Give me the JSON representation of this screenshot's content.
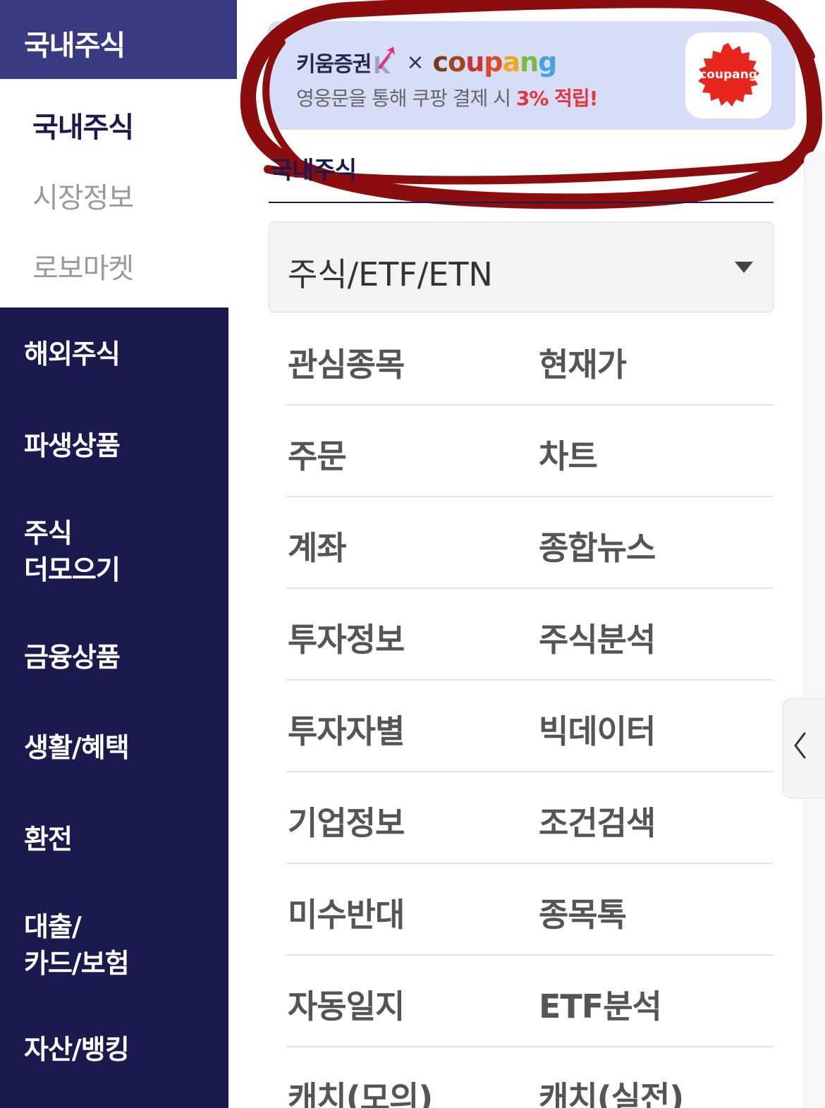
{
  "sidebar": {
    "active_category": "국내주식",
    "sub_items": [
      {
        "label": "국내주식",
        "active": true
      },
      {
        "label": "시장정보",
        "active": false
      },
      {
        "label": "로보마켓",
        "active": false
      }
    ],
    "categories": [
      {
        "label": "해외주식"
      },
      {
        "label": "파생상품"
      },
      {
        "label": "주식\n더모으기"
      },
      {
        "label": "금융상품"
      },
      {
        "label": "생활/혜택"
      },
      {
        "label": "환전"
      },
      {
        "label": "대출/\n카드/보험"
      },
      {
        "label": "자산/뱅킹"
      }
    ]
  },
  "banner": {
    "brand_left": "키움증권",
    "times_symbol": "×",
    "brand_right": "coupang",
    "description_prefix": "영웅문을 통해 쿠팡 결제 시 ",
    "description_highlight": "3% 적립!",
    "app_icon_label": "coupang",
    "colors": {
      "background": "#d5ddf7",
      "highlight": "#e8323c",
      "badge": "#e8261e"
    }
  },
  "section": {
    "title": "국내주식"
  },
  "dropdown": {
    "selected": "주식/ETF/ETN"
  },
  "menu": {
    "rows": [
      {
        "left": "관심종목",
        "right": "현재가"
      },
      {
        "left": "주문",
        "right": "차트"
      },
      {
        "left": "계좌",
        "right": "종합뉴스"
      },
      {
        "left": "투자정보",
        "right": "주식분석"
      },
      {
        "left": "투자자별",
        "right": "빅데이터"
      },
      {
        "left": "기업정보",
        "right": "조건검색"
      },
      {
        "left": "미수반대",
        "right": "종목톡"
      },
      {
        "left": "자동일지",
        "right": "ETF분석"
      },
      {
        "left": "캐치(모의)",
        "right": "캐치(실전)"
      }
    ]
  },
  "icons": {
    "dropdown": "caret-down-icon",
    "edge_handle": "chevron-left-icon",
    "kiwoom_logo": "kiwoom-arrow-logo",
    "coupang_app": "coupang-badge-icon"
  },
  "theme": {
    "sidebar_bg": "#1b1a4e",
    "sidebar_active_bg": "#3a3a82",
    "annotation": "#8b0d0d"
  }
}
